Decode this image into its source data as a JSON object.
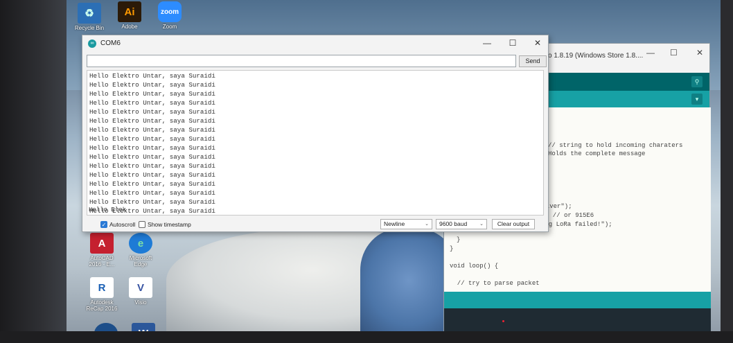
{
  "desktop": {
    "icons": [
      {
        "label": "Recycle Bin",
        "glyph": "♻",
        "color": "#2c6fb5"
      },
      {
        "label": "Adobe",
        "glyph": "Ai",
        "color": "#2b1a08"
      },
      {
        "label": "Zoom",
        "glyph": "zoom",
        "color": "#2d8cff"
      },
      {
        "label": "AutoCAD\n2016 - E...",
        "glyph": "A",
        "color": "#c5202f"
      },
      {
        "label": "Microsoft\nEdge",
        "glyph": "e",
        "color": "#1e7bd6"
      },
      {
        "label": "Autodesk\nReCap 2016",
        "glyph": "R",
        "color": "#ffffff"
      },
      {
        "label": "Visio",
        "glyph": "V",
        "color": "#ffffff"
      },
      {
        "label": "",
        "glyph": "W",
        "color": "#2b579a"
      },
      {
        "label": "",
        "glyph": "∞",
        "color": "#1d4e89"
      }
    ]
  },
  "ide": {
    "title": "o 1.8.19 (Windows Store 1.8....",
    "controls": {
      "minimize": "—",
      "maximize": "☐",
      "close": "✕"
    },
    "code_lines": [
      "// string to hold incoming charaters",
      "Holds the complete message",
      "ceiver\");",
      "( // or 915E6",
      "ing LoRa failed!\");",
      "}",
      "}",
      "void loop() {",
      "  // try to parse packet"
    ]
  },
  "serial_monitor": {
    "title": "COM6",
    "controls": {
      "minimize": "—",
      "maximize": "☐",
      "close": "✕"
    },
    "input_value": "",
    "send_label": "Send",
    "output_lines": [
      "Hello Elektro Untar, saya Suraidi",
      "Hello Elektro Untar, saya Suraidi",
      "Hello Elektro Untar, saya Suraidi",
      "Hello Elektro Untar, saya Suraidi",
      "Hello Elektro Untar, saya Suraidi",
      "Hello Elektro Untar, saya Suraidi",
      "Hello Elektro Untar, saya Suraidi",
      "Hello Elektro Untar, saya Suraidi",
      "Hello Elektro Untar, saya Suraidi",
      "Hello Elektro Untar, saya Suraidi",
      "Hello Elektro Untar, saya Suraidi",
      "Hello Elektro Untar, saya Suraidi",
      "Hello Elektro Untar, saya Suraidi",
      "Hello Elektro Untar, saya Suraidi",
      "Hello Elektro Untar, saya Suraidi",
      "Hello Elektro Untar, saya Suraidi",
      "Hello Elek"
    ],
    "autoscroll_label": "Autoscroll",
    "autoscroll_checked": true,
    "timestamp_label": "Show timestamp",
    "timestamp_checked": false,
    "line_ending": "Newline",
    "baud_rate": "9600 baud",
    "clear_label": "Clear output"
  }
}
